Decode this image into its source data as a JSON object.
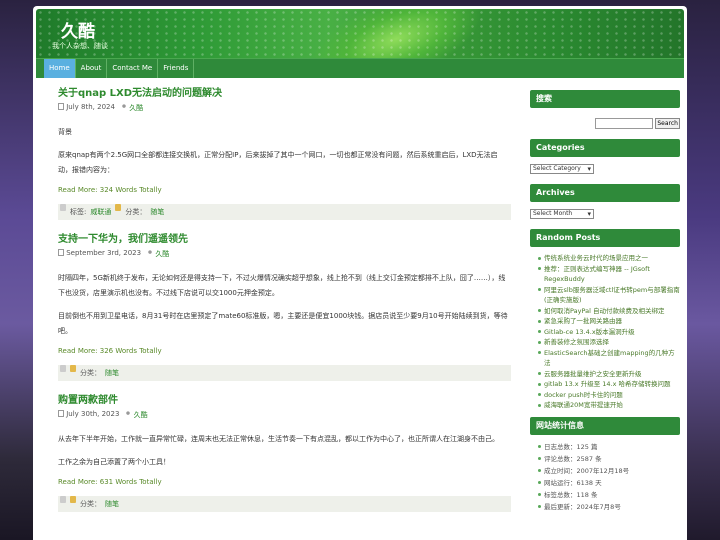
{
  "site": {
    "title": "久酷",
    "description": "我个人杂想、随谈"
  },
  "nav": [
    {
      "label": "Home",
      "active": true
    },
    {
      "label": "About",
      "active": false
    },
    {
      "label": "Contact Me",
      "active": false
    },
    {
      "label": "Friends",
      "active": false
    }
  ],
  "posts": [
    {
      "title": "关于qnap LXD无法启动的问题解决",
      "date": "July 8th, 2024",
      "author": "久酷",
      "paragraphs": [
        "背景",
        "原来qnap有两个2.5G网口全部都连接交换机，正常分配IP，后来拔掉了其中一个网口，一切也都正常没有问题，然后系统重启后，LXD无法启动，报错内容为："
      ],
      "readmore": "Read More: 324 Words Totally",
      "tags_label": "标签:",
      "tags": "威联通",
      "category_label": "分类：",
      "category": "随笔"
    },
    {
      "title": "支持一下华为，我们遥遥领先",
      "date": "September 3rd, 2023",
      "author": "久酷",
      "paragraphs": [
        "时隔四年，5G新机终于发布，无论如何还是得支持一下，不过火爆情况确实超乎想象，线上抢不到（线上交订金预定都排不上队，囧了……），线下也没货，店里演示机也没有。不过线下店说可以交1000元押金预定。",
        "目前倒也不用到卫星电话，8月31号时在店里预定了mate60标准版，嗯，主要还是便宜1000块钱。据店员说至少要9月10号开始陆续到货，等待吧。"
      ],
      "readmore": "Read More: 326 Words Totally",
      "tags_label": "",
      "tags": "",
      "category_label": "分类：",
      "category": "随笔"
    },
    {
      "title": "购置两款部件",
      "date": "July 30th, 2023",
      "author": "久酷",
      "paragraphs": [
        "从去年下半年开始，工作就一直异常忙碌，连周末也无法正常休息，生活节奏一下有点混乱，都以工作为中心了，也正所谓人在江湖身不由己。",
        "工作之余为自己添置了两个小工具！"
      ],
      "readmore": "Read More: 631 Words Totally",
      "tags_label": "",
      "tags": "",
      "category_label": "分类：",
      "category": "随笔"
    }
  ],
  "sidebar": {
    "search": {
      "title": "搜索",
      "button": "Search",
      "placeholder": ""
    },
    "categories": {
      "title": "Categories",
      "select": "Select Category"
    },
    "archives": {
      "title": "Archives",
      "select": "Select Month"
    },
    "random_posts": {
      "title": "Random Posts",
      "items": [
        "传统系统业务云时代的场景应用之一",
        "推荐：正则表达式编写神器 -- JGsoft RegexBuddy",
        "阿里云slb服务器泛域ctl证书转pem与部署指南(正确实施版)",
        "如何取消PayPal 自动付款续费及相关绑定",
        "紧急采购了一批网关路由器",
        "Gitlab-ce 13.4.x版本漏洞升级",
        "新善装修之氛围添选择",
        "ElasticSearch基础之创建mapping的几种方法",
        "云服务器批量维护之安全更新升级",
        "gitlab 13.x 升级至 14.x 哈希存储转换问题",
        "docker push时卡住的问题",
        "威海联通20M宽带提速开始"
      ]
    },
    "stats": {
      "title": "网站统计信息",
      "items": [
        "日志总数：125 篇",
        "评论总数：2587 条",
        "成立时间：2007年12月18号",
        "网站运行：6138 天",
        "标签总数：118 条",
        "最后更新：2024年7月8号"
      ]
    }
  }
}
